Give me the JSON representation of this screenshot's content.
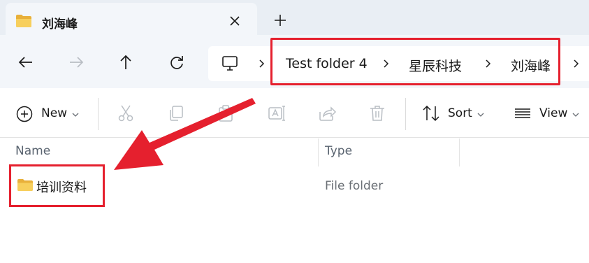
{
  "tab": {
    "title": "刘海峰",
    "close_icon": "close-icon",
    "new_tab_icon": "plus-icon"
  },
  "nav": {
    "back_icon": "arrow-left-icon",
    "forward_icon": "arrow-right-icon",
    "up_icon": "arrow-up-icon",
    "refresh_icon": "refresh-icon"
  },
  "breadcrumb": {
    "root_icon": "monitor-icon",
    "items": [
      "Test folder 4",
      "星辰科技",
      "刘海峰"
    ]
  },
  "toolbar": {
    "new_label": "New",
    "sort_label": "Sort",
    "view_label": "View",
    "disabled_icons": [
      "cut-icon",
      "copy-icon",
      "paste-icon",
      "rename-icon",
      "share-icon",
      "delete-icon"
    ]
  },
  "columns": {
    "name": "Name",
    "type": "Type"
  },
  "rows": [
    {
      "name": "培训资料",
      "type": "File folder"
    }
  ],
  "colors": {
    "annotation_red": "#e5202e",
    "folder_yellow": "#f2c14e"
  }
}
